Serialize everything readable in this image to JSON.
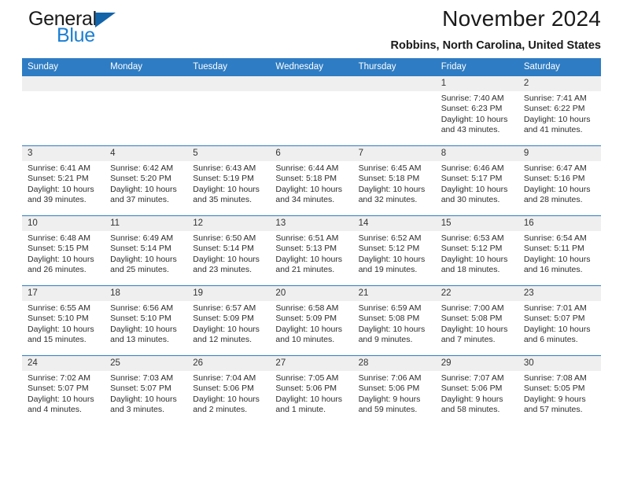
{
  "brand": {
    "name_top": "General",
    "name_bottom": "Blue",
    "accent_blue": "#1a7fd4",
    "triangle_blue": "#1464aa"
  },
  "header": {
    "title": "November 2024",
    "subtitle": "Robbins, North Carolina, United States"
  },
  "theme": {
    "header_bg": "#2e7cc3",
    "daynum_bg": "#efefef",
    "text": "#2d2d2d"
  },
  "weekdays": [
    "Sunday",
    "Monday",
    "Tuesday",
    "Wednesday",
    "Thursday",
    "Friday",
    "Saturday"
  ],
  "weeks": [
    {
      "days": [
        {
          "num": "",
          "sunrise": "",
          "sunset": "",
          "daylight_1": "",
          "daylight_2": ""
        },
        {
          "num": "",
          "sunrise": "",
          "sunset": "",
          "daylight_1": "",
          "daylight_2": ""
        },
        {
          "num": "",
          "sunrise": "",
          "sunset": "",
          "daylight_1": "",
          "daylight_2": ""
        },
        {
          "num": "",
          "sunrise": "",
          "sunset": "",
          "daylight_1": "",
          "daylight_2": ""
        },
        {
          "num": "",
          "sunrise": "",
          "sunset": "",
          "daylight_1": "",
          "daylight_2": ""
        },
        {
          "num": "1",
          "sunrise": "Sunrise: 7:40 AM",
          "sunset": "Sunset: 6:23 PM",
          "daylight_1": "Daylight: 10 hours",
          "daylight_2": "and 43 minutes."
        },
        {
          "num": "2",
          "sunrise": "Sunrise: 7:41 AM",
          "sunset": "Sunset: 6:22 PM",
          "daylight_1": "Daylight: 10 hours",
          "daylight_2": "and 41 minutes."
        }
      ]
    },
    {
      "days": [
        {
          "num": "3",
          "sunrise": "Sunrise: 6:41 AM",
          "sunset": "Sunset: 5:21 PM",
          "daylight_1": "Daylight: 10 hours",
          "daylight_2": "and 39 minutes."
        },
        {
          "num": "4",
          "sunrise": "Sunrise: 6:42 AM",
          "sunset": "Sunset: 5:20 PM",
          "daylight_1": "Daylight: 10 hours",
          "daylight_2": "and 37 minutes."
        },
        {
          "num": "5",
          "sunrise": "Sunrise: 6:43 AM",
          "sunset": "Sunset: 5:19 PM",
          "daylight_1": "Daylight: 10 hours",
          "daylight_2": "and 35 minutes."
        },
        {
          "num": "6",
          "sunrise": "Sunrise: 6:44 AM",
          "sunset": "Sunset: 5:18 PM",
          "daylight_1": "Daylight: 10 hours",
          "daylight_2": "and 34 minutes."
        },
        {
          "num": "7",
          "sunrise": "Sunrise: 6:45 AM",
          "sunset": "Sunset: 5:18 PM",
          "daylight_1": "Daylight: 10 hours",
          "daylight_2": "and 32 minutes."
        },
        {
          "num": "8",
          "sunrise": "Sunrise: 6:46 AM",
          "sunset": "Sunset: 5:17 PM",
          "daylight_1": "Daylight: 10 hours",
          "daylight_2": "and 30 minutes."
        },
        {
          "num": "9",
          "sunrise": "Sunrise: 6:47 AM",
          "sunset": "Sunset: 5:16 PM",
          "daylight_1": "Daylight: 10 hours",
          "daylight_2": "and 28 minutes."
        }
      ]
    },
    {
      "days": [
        {
          "num": "10",
          "sunrise": "Sunrise: 6:48 AM",
          "sunset": "Sunset: 5:15 PM",
          "daylight_1": "Daylight: 10 hours",
          "daylight_2": "and 26 minutes."
        },
        {
          "num": "11",
          "sunrise": "Sunrise: 6:49 AM",
          "sunset": "Sunset: 5:14 PM",
          "daylight_1": "Daylight: 10 hours",
          "daylight_2": "and 25 minutes."
        },
        {
          "num": "12",
          "sunrise": "Sunrise: 6:50 AM",
          "sunset": "Sunset: 5:14 PM",
          "daylight_1": "Daylight: 10 hours",
          "daylight_2": "and 23 minutes."
        },
        {
          "num": "13",
          "sunrise": "Sunrise: 6:51 AM",
          "sunset": "Sunset: 5:13 PM",
          "daylight_1": "Daylight: 10 hours",
          "daylight_2": "and 21 minutes."
        },
        {
          "num": "14",
          "sunrise": "Sunrise: 6:52 AM",
          "sunset": "Sunset: 5:12 PM",
          "daylight_1": "Daylight: 10 hours",
          "daylight_2": "and 19 minutes."
        },
        {
          "num": "15",
          "sunrise": "Sunrise: 6:53 AM",
          "sunset": "Sunset: 5:12 PM",
          "daylight_1": "Daylight: 10 hours",
          "daylight_2": "and 18 minutes."
        },
        {
          "num": "16",
          "sunrise": "Sunrise: 6:54 AM",
          "sunset": "Sunset: 5:11 PM",
          "daylight_1": "Daylight: 10 hours",
          "daylight_2": "and 16 minutes."
        }
      ]
    },
    {
      "days": [
        {
          "num": "17",
          "sunrise": "Sunrise: 6:55 AM",
          "sunset": "Sunset: 5:10 PM",
          "daylight_1": "Daylight: 10 hours",
          "daylight_2": "and 15 minutes."
        },
        {
          "num": "18",
          "sunrise": "Sunrise: 6:56 AM",
          "sunset": "Sunset: 5:10 PM",
          "daylight_1": "Daylight: 10 hours",
          "daylight_2": "and 13 minutes."
        },
        {
          "num": "19",
          "sunrise": "Sunrise: 6:57 AM",
          "sunset": "Sunset: 5:09 PM",
          "daylight_1": "Daylight: 10 hours",
          "daylight_2": "and 12 minutes."
        },
        {
          "num": "20",
          "sunrise": "Sunrise: 6:58 AM",
          "sunset": "Sunset: 5:09 PM",
          "daylight_1": "Daylight: 10 hours",
          "daylight_2": "and 10 minutes."
        },
        {
          "num": "21",
          "sunrise": "Sunrise: 6:59 AM",
          "sunset": "Sunset: 5:08 PM",
          "daylight_1": "Daylight: 10 hours",
          "daylight_2": "and 9 minutes."
        },
        {
          "num": "22",
          "sunrise": "Sunrise: 7:00 AM",
          "sunset": "Sunset: 5:08 PM",
          "daylight_1": "Daylight: 10 hours",
          "daylight_2": "and 7 minutes."
        },
        {
          "num": "23",
          "sunrise": "Sunrise: 7:01 AM",
          "sunset": "Sunset: 5:07 PM",
          "daylight_1": "Daylight: 10 hours",
          "daylight_2": "and 6 minutes."
        }
      ]
    },
    {
      "days": [
        {
          "num": "24",
          "sunrise": "Sunrise: 7:02 AM",
          "sunset": "Sunset: 5:07 PM",
          "daylight_1": "Daylight: 10 hours",
          "daylight_2": "and 4 minutes."
        },
        {
          "num": "25",
          "sunrise": "Sunrise: 7:03 AM",
          "sunset": "Sunset: 5:07 PM",
          "daylight_1": "Daylight: 10 hours",
          "daylight_2": "and 3 minutes."
        },
        {
          "num": "26",
          "sunrise": "Sunrise: 7:04 AM",
          "sunset": "Sunset: 5:06 PM",
          "daylight_1": "Daylight: 10 hours",
          "daylight_2": "and 2 minutes."
        },
        {
          "num": "27",
          "sunrise": "Sunrise: 7:05 AM",
          "sunset": "Sunset: 5:06 PM",
          "daylight_1": "Daylight: 10 hours",
          "daylight_2": "and 1 minute."
        },
        {
          "num": "28",
          "sunrise": "Sunrise: 7:06 AM",
          "sunset": "Sunset: 5:06 PM",
          "daylight_1": "Daylight: 9 hours",
          "daylight_2": "and 59 minutes."
        },
        {
          "num": "29",
          "sunrise": "Sunrise: 7:07 AM",
          "sunset": "Sunset: 5:06 PM",
          "daylight_1": "Daylight: 9 hours",
          "daylight_2": "and 58 minutes."
        },
        {
          "num": "30",
          "sunrise": "Sunrise: 7:08 AM",
          "sunset": "Sunset: 5:05 PM",
          "daylight_1": "Daylight: 9 hours",
          "daylight_2": "and 57 minutes."
        }
      ]
    }
  ]
}
